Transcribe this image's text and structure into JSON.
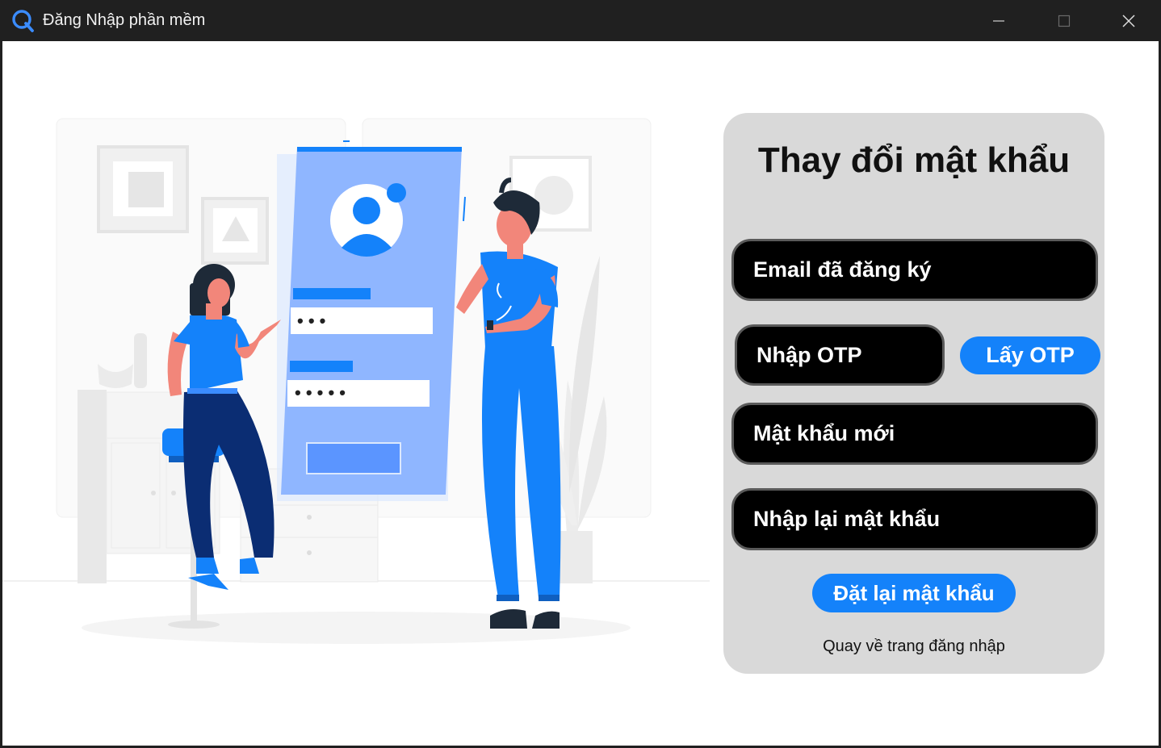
{
  "window": {
    "title": "Đăng Nhập phần mềm",
    "app_icon": "q-logo-icon",
    "accent": "#1482fa",
    "controls": [
      "minimize-icon",
      "maximize-icon",
      "close-icon"
    ]
  },
  "form": {
    "title": "Thay đổi mật khẩu",
    "email_placeholder": "Email đã đăng ký",
    "otp_placeholder": "Nhập OTP",
    "get_otp_label": "Lấy OTP",
    "new_password_placeholder": "Mật khẩu mới",
    "confirm_password_placeholder": "Nhập lại mật khẩu",
    "reset_label": "Đặt lại mật khẩu",
    "back_link": "Quay về trang đăng nhập"
  },
  "illustration": {
    "name": "login-illustration",
    "password_dots_1": "• • •",
    "password_dots_2": "• • • • •"
  }
}
